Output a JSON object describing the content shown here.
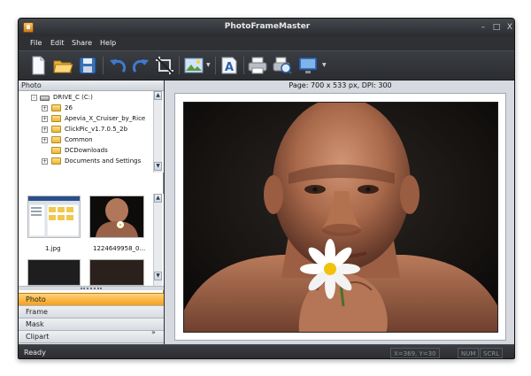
{
  "window": {
    "title": "PhotoFrameMaster",
    "minimize": "–",
    "maximize": "□",
    "close": "X"
  },
  "menu": [
    "File",
    "Edit",
    "Share",
    "Help"
  ],
  "toolbar": {
    "buttons": [
      "new",
      "open",
      "save",
      "undo",
      "redo",
      "crop",
      "image",
      "text",
      "print",
      "print-preview",
      "monitor"
    ]
  },
  "left_panel": {
    "header": "Photo",
    "tree": [
      {
        "label": "DRIVE_C (C:)",
        "type": "drive",
        "expander": "-"
      },
      {
        "label": "26",
        "type": "folder",
        "expander": "+"
      },
      {
        "label": "Apevia_X_Cruiser_by_Rice",
        "type": "folder",
        "expander": "+"
      },
      {
        "label": "ClickPic_v1.7.0.5_2b",
        "type": "folder",
        "expander": "+"
      },
      {
        "label": "Common",
        "type": "folder",
        "expander": "+"
      },
      {
        "label": "DCDownloads",
        "type": "folder",
        "expander": ""
      },
      {
        "label": "Documents and Settings",
        "type": "folder",
        "expander": "+"
      }
    ],
    "thumbnails": [
      {
        "label": "1.jpg"
      },
      {
        "label": "1224649958_0..."
      }
    ],
    "tabs": [
      "Photo",
      "Frame",
      "Mask",
      "Clipart"
    ],
    "active_tab": "Photo",
    "more": "»"
  },
  "canvas": {
    "page_info": "Page: 700 x 533 px, DPI: 300"
  },
  "status": {
    "ready": "Ready",
    "coords": "X=369, Y=30",
    "num": "NUM",
    "scrl": "SCRL"
  },
  "colors": {
    "accent": "#f4a21b",
    "chrome": "#2e3034",
    "canvas_bg": "#d6dae0"
  }
}
